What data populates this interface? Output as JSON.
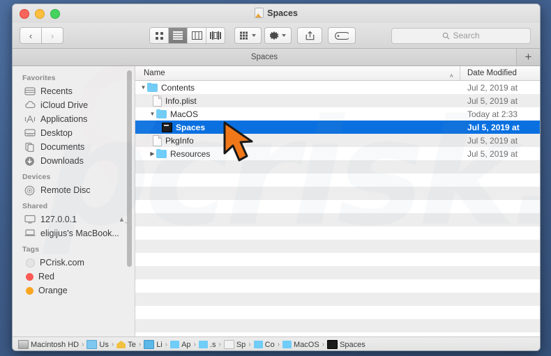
{
  "window": {
    "title": "Spaces",
    "title_icon": "app-icon",
    "traffic_lights": [
      "close",
      "minimize",
      "zoom"
    ],
    "colors": {
      "selection_blue": "#0a70e0",
      "folder_blue": "#6fcdf7",
      "desktop": "#41628f",
      "chrome": "#ececec"
    }
  },
  "toolbar": {
    "back_label": "‹",
    "forward_label": "›",
    "view_modes": [
      {
        "name": "icon-view",
        "selected": false
      },
      {
        "name": "list-view",
        "selected": true
      },
      {
        "name": "column-view",
        "selected": false
      },
      {
        "name": "gallery-view",
        "selected": false
      }
    ],
    "arrange_label": "arrange-icon",
    "action_label": "gear-icon",
    "share_label": "share-icon",
    "tag_label": "tag-icon",
    "search_placeholder": "Search"
  },
  "tabbar": {
    "tabs": [
      {
        "label": "Spaces",
        "active": true
      }
    ],
    "new_tab_label": "+"
  },
  "sidebar": {
    "sections": [
      {
        "heading": "Favorites",
        "items": [
          {
            "label": "Recents",
            "icon": "clock-recents-icon"
          },
          {
            "label": "iCloud Drive",
            "icon": "cloud-icon"
          },
          {
            "label": "Applications",
            "icon": "applications-icon"
          },
          {
            "label": "Desktop",
            "icon": "desktop-icon"
          },
          {
            "label": "Documents",
            "icon": "documents-icon"
          },
          {
            "label": "Downloads",
            "icon": "downloads-icon"
          }
        ]
      },
      {
        "heading": "Devices",
        "items": [
          {
            "label": "Remote Disc",
            "icon": "disc-icon"
          }
        ]
      },
      {
        "heading": "Shared",
        "items": [
          {
            "label": "127.0.0.1",
            "icon": "monitor-icon",
            "eject": true
          },
          {
            "label": "eligijus's MacBook...",
            "icon": "laptop-icon"
          }
        ]
      },
      {
        "heading": "Tags",
        "items": [
          {
            "label": "PCrisk.com",
            "icon": "tag-dot",
            "color": "#e0e0e0"
          },
          {
            "label": "Red",
            "icon": "tag-dot",
            "color": "#fc5b55"
          },
          {
            "label": "Orange",
            "icon": "tag-dot",
            "color": "#f8a622"
          }
        ]
      }
    ]
  },
  "filelist": {
    "columns": [
      {
        "label": "Name",
        "sorted": true,
        "sort_caret": "˄"
      },
      {
        "label": "Date Modified"
      }
    ],
    "rows": [
      {
        "name": "Contents",
        "date": "Jul 2, 2019 at",
        "type": "folder",
        "indent": 0,
        "twisty": "▼",
        "selected": false
      },
      {
        "name": "Info.plist",
        "date": "Jul 5, 2019 at",
        "type": "doc",
        "indent": 1,
        "twisty": "",
        "selected": false
      },
      {
        "name": "MacOS",
        "date": "Today at 2:33",
        "type": "folder",
        "indent": 1,
        "twisty": "▼",
        "selected": false
      },
      {
        "name": "Spaces",
        "date": "Jul 5, 2019 at",
        "type": "exec",
        "indent": 2,
        "twisty": "",
        "selected": true
      },
      {
        "name": "PkgInfo",
        "date": "Jul 5, 2019 at",
        "type": "doc",
        "indent": 1,
        "twisty": "",
        "selected": false
      },
      {
        "name": "Resources",
        "date": "Jul 5, 2019 at",
        "type": "folder",
        "indent": 1,
        "twisty": "▶",
        "selected": false
      }
    ],
    "empty_rows": 13
  },
  "pathbar": {
    "segments": [
      {
        "label": "Macintosh HD",
        "icon": "disk",
        "wide": true
      },
      {
        "label": "Us",
        "icon": "user",
        "wide": false
      },
      {
        "label": "Te",
        "icon": "home",
        "wide": false
      },
      {
        "label": "Li",
        "icon": "lib",
        "wide": false
      },
      {
        "label": "Ap",
        "icon": "folder",
        "wide": false
      },
      {
        "label": ".s",
        "icon": "folder",
        "wide": false
      },
      {
        "label": "Sp",
        "icon": "app",
        "wide": false
      },
      {
        "label": "Co",
        "icon": "folder",
        "wide": false
      },
      {
        "label": "MacOS",
        "icon": "folder",
        "wide": true
      },
      {
        "label": "Spaces",
        "icon": "exec",
        "wide": true
      }
    ],
    "separator": "›"
  },
  "cursor": {
    "name": "orange-arrow-pointer",
    "color": "#f07818"
  },
  "watermark": {
    "text": "pcrisk.com"
  }
}
